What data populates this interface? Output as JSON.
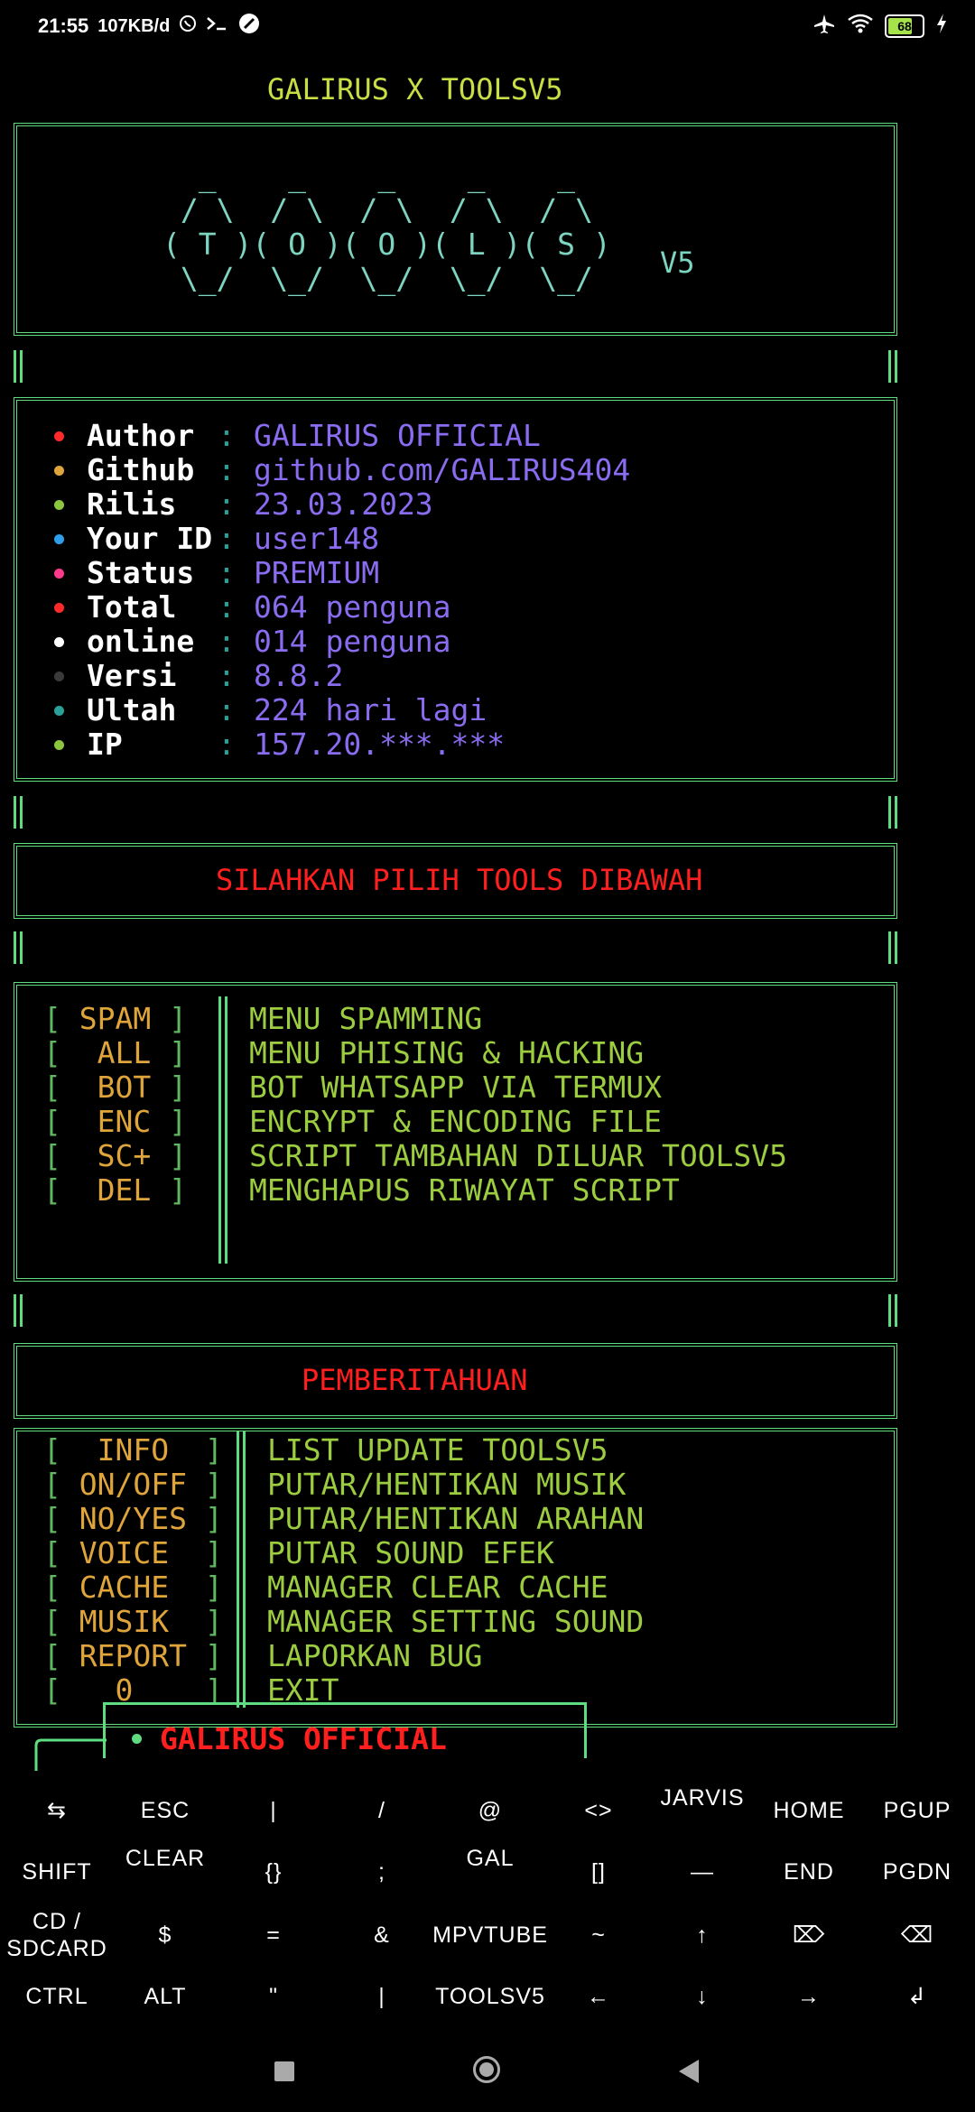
{
  "status_bar": {
    "time": "21:55",
    "speed": "107KB/d",
    "icons_left": [
      "whatsapp-icon",
      "terminal-icon",
      "compass-icon"
    ],
    "icons_right": [
      "airplane-icon",
      "wifi-icon",
      "battery-icon",
      "charging-icon"
    ],
    "battery_level": "68"
  },
  "terminal": {
    "title": "GALIRUS X TOOLSV5",
    "ascii_logo": [
      "  _    _    _    _    _  ",
      " / \\  / \\  / \\  / \\  / \\ ",
      "( T )( O )( O )( L )( S )",
      " \\_/  \\_/  \\_/  \\_/  \\_/ "
    ],
    "logo_suffix": "V5",
    "info": [
      {
        "dot_color": "#ff2a2a",
        "label": "Author",
        "value": "GALIRUS OFFICIAL"
      },
      {
        "dot_color": "#e0a53a",
        "label": "Github",
        "value": "github.com/GALIRUS404"
      },
      {
        "dot_color": "#8cc63f",
        "label": "Rilis",
        "value": "23.03.2023"
      },
      {
        "dot_color": "#2e9ee8",
        "label": "Your ID",
        "value": "user148"
      },
      {
        "dot_color": "#ff3a8c",
        "label": "Status",
        "value": "PREMIUM"
      },
      {
        "dot_color": "#ff2a2a",
        "label": "Total",
        "value": "064 penguna"
      },
      {
        "dot_color": "#ffffff",
        "label": "online",
        "value": "014 penguna"
      },
      {
        "dot_color": "#3a3a3a",
        "label": "Versi",
        "value": "8.8.2"
      },
      {
        "dot_color": "#2aa198",
        "label": "Ultah",
        "value": "224 hari lagi"
      },
      {
        "dot_color": "#8cc63f",
        "label": "IP",
        "value": "157.20.***.***"
      }
    ],
    "colon": ":",
    "choose_banner": "SILAHKAN PILIH TOOLS DIBAWAH",
    "menu": [
      {
        "code": " SPAM ",
        "desc": "MENU SPAMMING"
      },
      {
        "code": "  ALL ",
        "desc": "MENU PHISING & HACKING"
      },
      {
        "code": "  BOT ",
        "desc": "BOT WHATSAPP VIA TERMUX"
      },
      {
        "code": "  ENC ",
        "desc": "ENCRYPT & ENCODING FILE"
      },
      {
        "code": "  SC+ ",
        "desc": "SCRIPT TAMBAHAN DILUAR TOOLSV5"
      },
      {
        "code": "  DEL ",
        "desc": "MENGHAPUS RIWAYAT SCRIPT"
      }
    ],
    "notice_banner": "PEMBERITAHUAN",
    "notices": [
      {
        "code": "  INFO  ",
        "desc": "LIST UPDATE TOOLSV5"
      },
      {
        "code": " ON/OFF ",
        "desc": "PUTAR/HENTIKAN MUSIK"
      },
      {
        "code": " NO/YES ",
        "desc": "PUTAR/HENTIKAN ARAHAN"
      },
      {
        "code": " VOICE  ",
        "desc": "PUTAR SOUND EFEK"
      },
      {
        "code": " CACHE  ",
        "desc": "MANAGER CLEAR CACHE"
      },
      {
        "code": " MUSIK  ",
        "desc": "MANAGER SETTING SOUND"
      },
      {
        "code": " REPORT ",
        "desc": "LAPORKAN BUG"
      },
      {
        "code": "   0    ",
        "desc": "EXIT"
      }
    ],
    "prompt_label": "GALIRUS OFFICIAL"
  },
  "extra_keys": [
    [
      "⇆",
      "ESC",
      "|",
      "/",
      "@",
      "<>",
      "JARVIS",
      "HOME",
      "PGUP"
    ],
    [
      "SHIFT",
      "CLEAR",
      "{}",
      ";",
      "GAL",
      "[]",
      "—",
      "END",
      "PGDN"
    ],
    [
      "CD / SDCARD",
      "$",
      "=",
      "&",
      "MPVTUBE",
      "~",
      "↑",
      "⌦",
      "⌫"
    ],
    [
      "CTRL",
      "ALT",
      "\"",
      "|",
      "TOOLSV5",
      "←",
      "↓",
      "→",
      "↲"
    ]
  ]
}
